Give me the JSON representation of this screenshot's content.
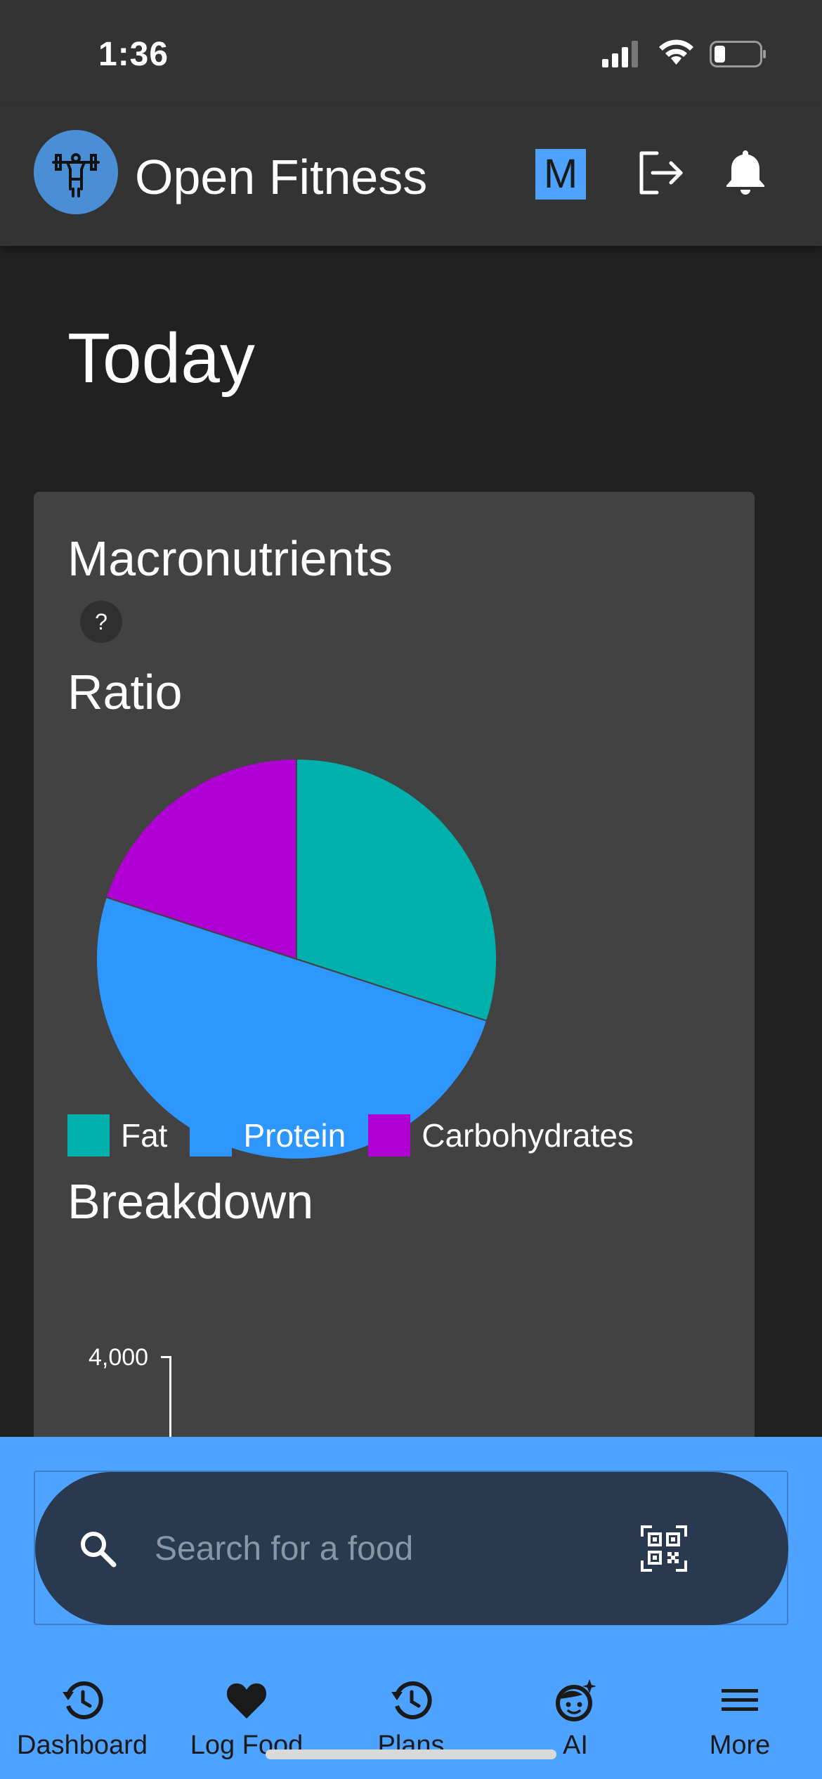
{
  "status_bar": {
    "time": "1:36"
  },
  "app_bar": {
    "title": "Open Fitness",
    "badge_letter": "M",
    "icons": [
      "dumbbell-logo-icon",
      "logout-icon",
      "bell-icon"
    ]
  },
  "page": {
    "title": "Today"
  },
  "macros_card": {
    "title": "Macronutrients",
    "help_label": "?",
    "ratio_title": "Ratio",
    "breakdown_title": "Breakdown",
    "breakdown_axis_top_label": "4,000"
  },
  "chart_data": {
    "type": "pie",
    "title": "Ratio",
    "slices": [
      {
        "label": "Fat",
        "value": 30,
        "color": "#00b0ad"
      },
      {
        "label": "Protein",
        "value": 50,
        "color": "#2e96ff"
      },
      {
        "label": "Carbohydrates",
        "value": 20,
        "color": "#b000d4"
      }
    ],
    "legend_position": "bottom"
  },
  "search": {
    "placeholder": "Search for a food"
  },
  "nav": {
    "items": [
      {
        "label": "Dashboard",
        "icon": "history-icon"
      },
      {
        "label": "Log Food",
        "icon": "heart-icon"
      },
      {
        "label": "Plans",
        "icon": "history-icon"
      },
      {
        "label": "AI",
        "icon": "face-sparkle-icon"
      },
      {
        "label": "More",
        "icon": "menu-icon"
      }
    ]
  },
  "colors": {
    "background": "#212121",
    "app_bar": "#333333",
    "card": "#424242",
    "accent": "#4da3ff",
    "search_bar": "#29394f"
  }
}
